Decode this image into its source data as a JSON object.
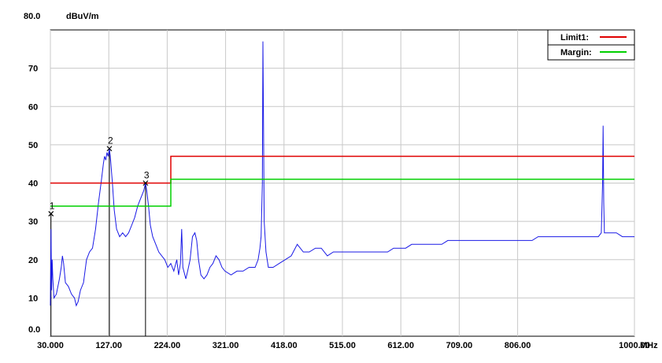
{
  "chart_data": {
    "type": "line",
    "y_unit": "dBuV/m",
    "x_unit": "MHz",
    "y_top_label": "80.0",
    "y_bottom_label": "0.0",
    "ylim": [
      0,
      80
    ],
    "xlim": [
      30,
      1000
    ],
    "x_tick_labels": [
      "30.000",
      "127.00",
      "224.00",
      "321.00",
      "418.00",
      "515.00",
      "612.00",
      "709.00",
      "806.00",
      "1000.00"
    ],
    "x_ticks": [
      30,
      127,
      224,
      321,
      418,
      515,
      612,
      709,
      806,
      1000
    ],
    "y_ticks": [
      10,
      20,
      30,
      40,
      50,
      60,
      70
    ],
    "y_tick_labels": [
      "10",
      "20",
      "30",
      "40",
      "50",
      "60",
      "70"
    ],
    "grid": true,
    "legend": {
      "position": "top-right",
      "entries": [
        {
          "label": "Limit1:",
          "color": "#e00000"
        },
        {
          "label": "Margin:",
          "color": "#00d000"
        }
      ]
    },
    "limit1": {
      "name": "Limit1:",
      "color": "#e00000",
      "points": [
        [
          30,
          40
        ],
        [
          230,
          40
        ],
        [
          230,
          47
        ],
        [
          1000,
          47
        ]
      ]
    },
    "margin": {
      "name": "Margin:",
      "color": "#00d000",
      "points": [
        [
          30,
          34
        ],
        [
          230,
          34
        ],
        [
          230,
          41
        ],
        [
          1000,
          41
        ]
      ]
    },
    "trace": {
      "color": "#1a1ae6",
      "points": [
        [
          30,
          8
        ],
        [
          31,
          28
        ],
        [
          32,
          12
        ],
        [
          33,
          20
        ],
        [
          34,
          15
        ],
        [
          36,
          10
        ],
        [
          40,
          11
        ],
        [
          45,
          15
        ],
        [
          48,
          18
        ],
        [
          50,
          21
        ],
        [
          52,
          19
        ],
        [
          55,
          14
        ],
        [
          60,
          13
        ],
        [
          65,
          11
        ],
        [
          70,
          10
        ],
        [
          73,
          8
        ],
        [
          76,
          9
        ],
        [
          80,
          12
        ],
        [
          85,
          14
        ],
        [
          90,
          20
        ],
        [
          95,
          22
        ],
        [
          100,
          23
        ],
        [
          105,
          28
        ],
        [
          110,
          35
        ],
        [
          115,
          41
        ],
        [
          118,
          45
        ],
        [
          120,
          47
        ],
        [
          122,
          46
        ],
        [
          124,
          48
        ],
        [
          126,
          47
        ],
        [
          128,
          49
        ],
        [
          130,
          46
        ],
        [
          133,
          40
        ],
        [
          136,
          33
        ],
        [
          140,
          28
        ],
        [
          145,
          26
        ],
        [
          150,
          27
        ],
        [
          155,
          26
        ],
        [
          160,
          27
        ],
        [
          165,
          29
        ],
        [
          170,
          31
        ],
        [
          175,
          34
        ],
        [
          180,
          36
        ],
        [
          185,
          38
        ],
        [
          188,
          40
        ],
        [
          190,
          38
        ],
        [
          193,
          34
        ],
        [
          196,
          29
        ],
        [
          200,
          26
        ],
        [
          205,
          24
        ],
        [
          210,
          22
        ],
        [
          215,
          21
        ],
        [
          220,
          20
        ],
        [
          225,
          18
        ],
        [
          230,
          19
        ],
        [
          235,
          17
        ],
        [
          240,
          20
        ],
        [
          243,
          16
        ],
        [
          246,
          19
        ],
        [
          248,
          28
        ],
        [
          250,
          18
        ],
        [
          255,
          15
        ],
        [
          258,
          17
        ],
        [
          262,
          20
        ],
        [
          266,
          26
        ],
        [
          270,
          27
        ],
        [
          273,
          25
        ],
        [
          276,
          20
        ],
        [
          280,
          16
        ],
        [
          285,
          15
        ],
        [
          290,
          16
        ],
        [
          295,
          18
        ],
        [
          300,
          19
        ],
        [
          305,
          21
        ],
        [
          310,
          20
        ],
        [
          315,
          18
        ],
        [
          320,
          17
        ],
        [
          330,
          16
        ],
        [
          340,
          17
        ],
        [
          350,
          17
        ],
        [
          360,
          18
        ],
        [
          370,
          18
        ],
        [
          375,
          20
        ],
        [
          378,
          23
        ],
        [
          380,
          26
        ],
        [
          382,
          40
        ],
        [
          383,
          77
        ],
        [
          384,
          55
        ],
        [
          385,
          30
        ],
        [
          388,
          22
        ],
        [
          392,
          18
        ],
        [
          400,
          18
        ],
        [
          410,
          19
        ],
        [
          420,
          20
        ],
        [
          430,
          21
        ],
        [
          440,
          24
        ],
        [
          450,
          22
        ],
        [
          460,
          22
        ],
        [
          470,
          23
        ],
        [
          480,
          23
        ],
        [
          490,
          21
        ],
        [
          500,
          22
        ],
        [
          510,
          22
        ],
        [
          520,
          22
        ],
        [
          530,
          22
        ],
        [
          540,
          22
        ],
        [
          550,
          22
        ],
        [
          560,
          22
        ],
        [
          570,
          22
        ],
        [
          580,
          22
        ],
        [
          590,
          22
        ],
        [
          600,
          23
        ],
        [
          610,
          23
        ],
        [
          620,
          23
        ],
        [
          630,
          24
        ],
        [
          640,
          24
        ],
        [
          650,
          24
        ],
        [
          660,
          24
        ],
        [
          670,
          24
        ],
        [
          680,
          24
        ],
        [
          690,
          25
        ],
        [
          700,
          25
        ],
        [
          710,
          25
        ],
        [
          720,
          25
        ],
        [
          730,
          25
        ],
        [
          740,
          25
        ],
        [
          750,
          25
        ],
        [
          760,
          25
        ],
        [
          770,
          25
        ],
        [
          780,
          25
        ],
        [
          790,
          25
        ],
        [
          800,
          25
        ],
        [
          810,
          25
        ],
        [
          820,
          25
        ],
        [
          830,
          25
        ],
        [
          840,
          26
        ],
        [
          850,
          26
        ],
        [
          860,
          26
        ],
        [
          870,
          26
        ],
        [
          880,
          26
        ],
        [
          890,
          26
        ],
        [
          900,
          26
        ],
        [
          910,
          26
        ],
        [
          920,
          26
        ],
        [
          930,
          26
        ],
        [
          940,
          26
        ],
        [
          945,
          27
        ],
        [
          947,
          40
        ],
        [
          948,
          55
        ],
        [
          949,
          35
        ],
        [
          950,
          27
        ],
        [
          960,
          27
        ],
        [
          970,
          27
        ],
        [
          980,
          26
        ],
        [
          990,
          26
        ],
        [
          1000,
          26
        ]
      ]
    },
    "markers": [
      {
        "label": "1",
        "x": 31,
        "y": 32
      },
      {
        "label": "2",
        "x": 128,
        "y": 49
      },
      {
        "label": "3",
        "x": 188,
        "y": 40
      }
    ]
  }
}
